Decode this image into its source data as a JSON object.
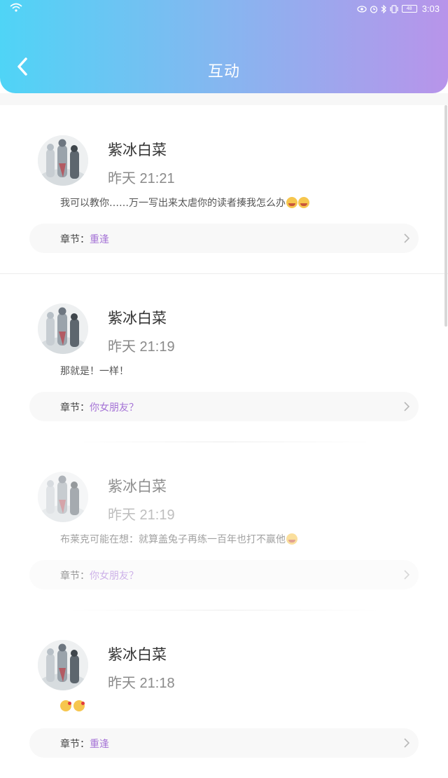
{
  "status_bar": {
    "time": "3:03",
    "battery": "48"
  },
  "header": {
    "title": "互动"
  },
  "chapter_label": "章节：",
  "items": [
    {
      "name": "紫冰白菜",
      "time": "昨天 21:21",
      "message": "我可以教你……万一写出来太虐你的读者揍我怎么办",
      "emojis": 2,
      "chapter": "重逢"
    },
    {
      "name": "紫冰白菜",
      "time": "昨天 21:19",
      "message": "那就是！一样！",
      "emojis": 0,
      "chapter": "你女朋友？"
    },
    {
      "name": "紫冰白菜",
      "time": "昨天 21:19",
      "message": "布莱克可能在想：就算盖兔子再练一百年也打不赢他",
      "emojis": 1,
      "chapter": "你女朋友？"
    },
    {
      "name": "紫冰白菜",
      "time": "昨天 21:18",
      "message": "",
      "emojis": 2,
      "chapter": "重逢"
    }
  ]
}
